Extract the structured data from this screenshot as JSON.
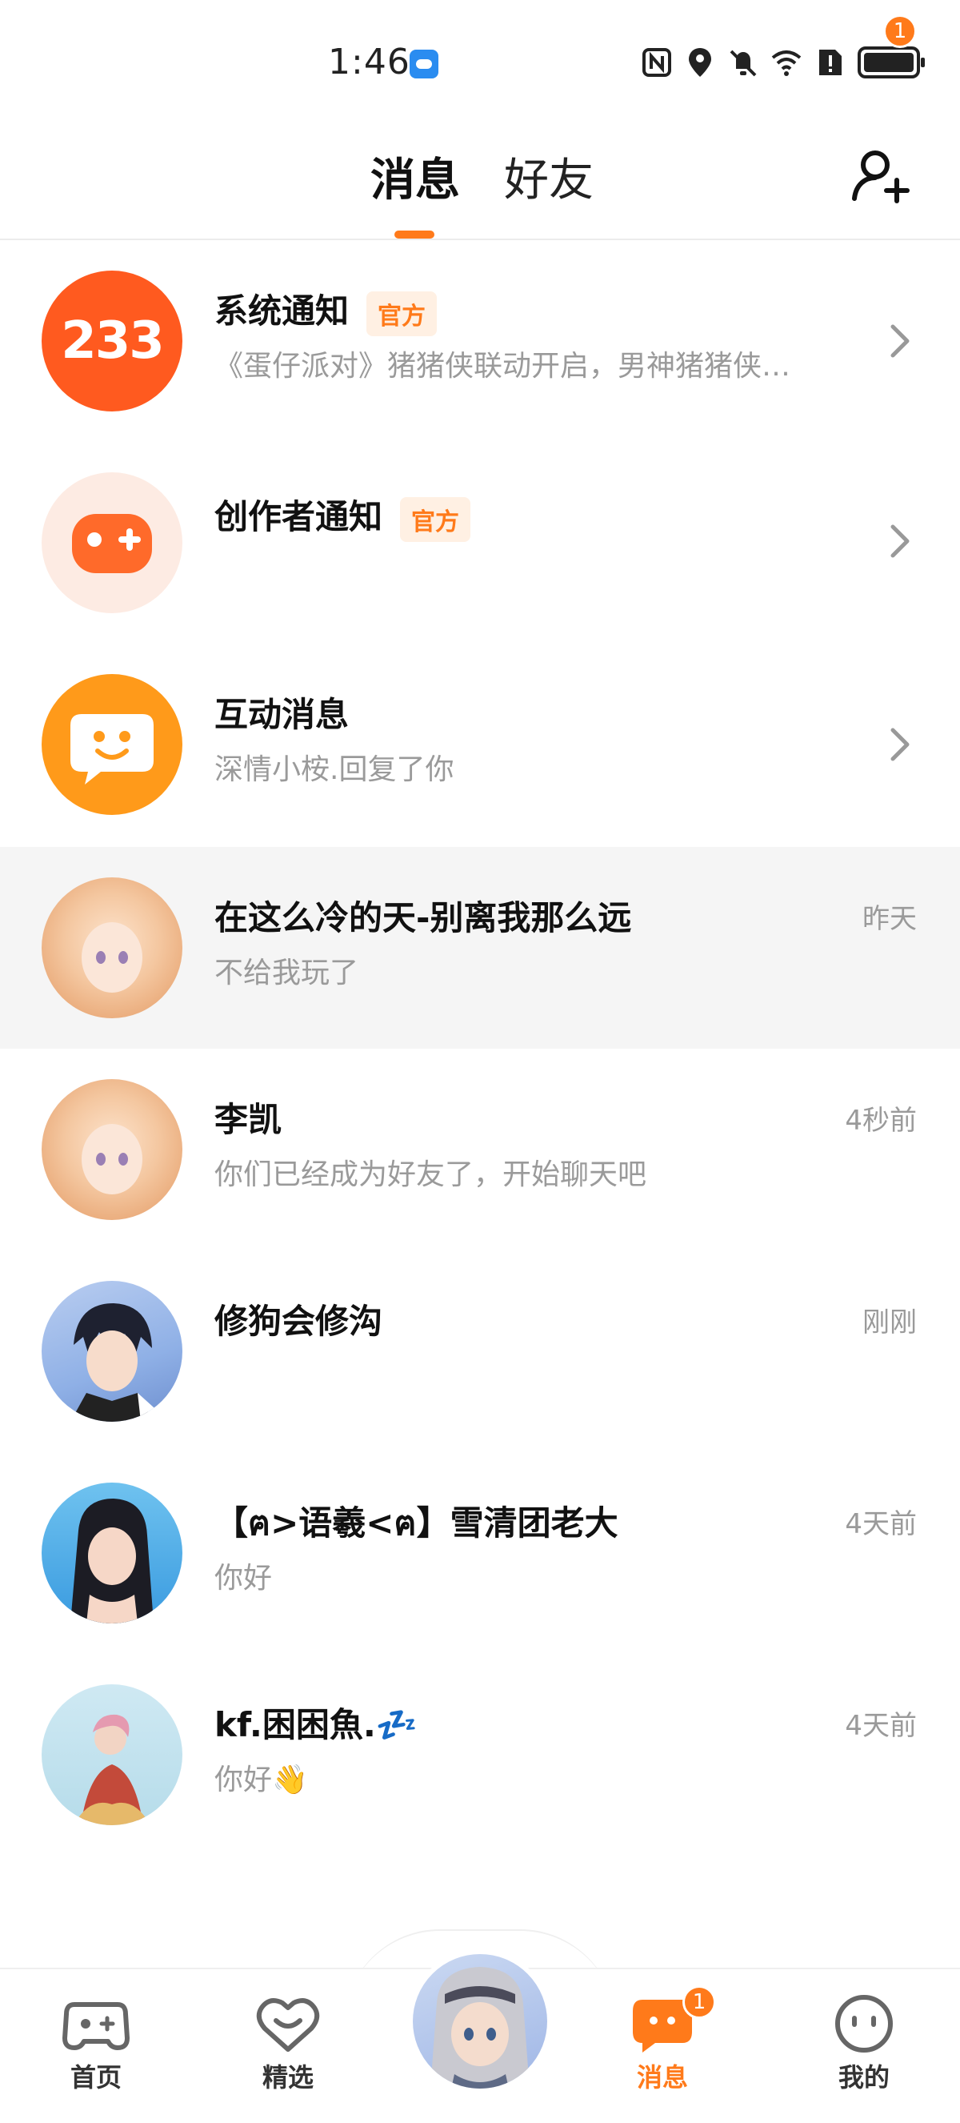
{
  "status_bar": {
    "time": "1:46"
  },
  "header": {
    "tabs": [
      {
        "label": "消息",
        "active": true
      },
      {
        "label": "好友",
        "active": false
      }
    ],
    "add_friend_badge": "1"
  },
  "official_tag": "官方",
  "messages": [
    {
      "name": "系统通知",
      "official": true,
      "preview": "《蛋仔派对》猪猪侠联动开启，男神猪猪侠…",
      "avatar_text": "233",
      "avatar_color": "#ff5a1f"
    },
    {
      "name": "创作者通知",
      "official": true,
      "preview": "",
      "avatar_color": "#fdebe3"
    },
    {
      "name": "互动消息",
      "preview": "深情小桉.回复了你",
      "avatar_color": "#ff9a1a"
    },
    {
      "name": "在这么冷的天-别离我那么远",
      "preview": "不给我玩了",
      "time": "昨天"
    },
    {
      "name": "李凯",
      "preview": "你们已经成为好友了，开始聊天吧",
      "time": "4秒前"
    },
    {
      "name": "修狗会修沟",
      "preview": "",
      "time": "刚刚"
    },
    {
      "name": "【ฅ>语羲<ฅ】雪清团老大",
      "preview": "你好",
      "time": "4天前"
    },
    {
      "name": "kf.困困魚.💤",
      "preview": "你好👋",
      "time": "4天前"
    }
  ],
  "bottom_nav": {
    "items": [
      {
        "label": "首页",
        "icon": "gamepad-icon"
      },
      {
        "label": "精选",
        "icon": "heart-chat-icon"
      },
      {
        "label": "消息",
        "icon": "message-icon",
        "active": true,
        "badge": "1"
      },
      {
        "label": "我的",
        "icon": "smiley-icon"
      }
    ]
  },
  "colors": {
    "accent": "#ff7a1a",
    "muted_text": "#9a9a9a",
    "highlight_row": "#f5f5f5"
  }
}
